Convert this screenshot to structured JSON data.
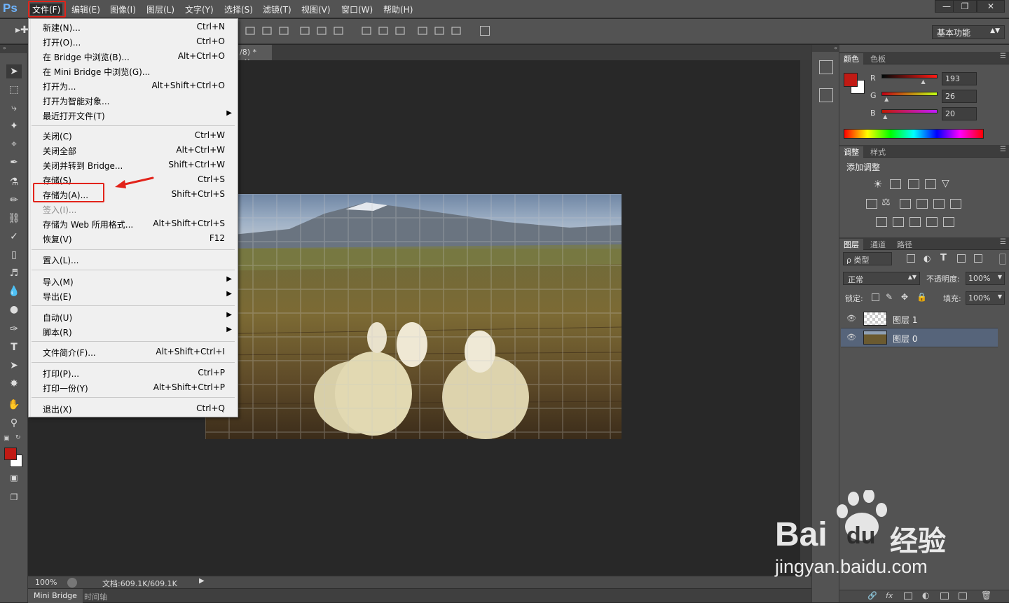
{
  "app": {
    "logo": "Ps"
  },
  "menubar": {
    "items": [
      {
        "label": "文件(F)",
        "active": true
      },
      {
        "label": "编辑(E)"
      },
      {
        "label": "图像(I)"
      },
      {
        "label": "图层(L)"
      },
      {
        "label": "文字(Y)"
      },
      {
        "label": "选择(S)"
      },
      {
        "label": "滤镜(T)"
      },
      {
        "label": "视图(V)"
      },
      {
        "label": "窗口(W)"
      },
      {
        "label": "帮助(H)"
      }
    ],
    "window_buttons": [
      "minimize-icon",
      "restore-icon",
      "close-icon"
    ]
  },
  "options_bar": {
    "workspace": "基本功能"
  },
  "document": {
    "tab_title_fragment": "/8) *",
    "tab_close": "×"
  },
  "file_menu": {
    "groups": [
      [
        {
          "label": "新建(N)...",
          "shortcut": "Ctrl+N"
        },
        {
          "label": "打开(O)...",
          "shortcut": "Ctrl+O"
        },
        {
          "label": "在 Bridge 中浏览(B)...",
          "shortcut": "Alt+Ctrl+O"
        },
        {
          "label": "在 Mini Bridge 中浏览(G)...",
          "shortcut": ""
        },
        {
          "label": "打开为...",
          "shortcut": "Alt+Shift+Ctrl+O"
        },
        {
          "label": "打开为智能对象...",
          "shortcut": ""
        },
        {
          "label": "最近打开文件(T)",
          "shortcut": "",
          "submenu": true
        }
      ],
      [
        {
          "label": "关闭(C)",
          "shortcut": "Ctrl+W"
        },
        {
          "label": "关闭全部",
          "shortcut": "Alt+Ctrl+W"
        },
        {
          "label": "关闭并转到 Bridge...",
          "shortcut": "Shift+Ctrl+W"
        },
        {
          "label": "存储(S)",
          "shortcut": "Ctrl+S"
        },
        {
          "label": "存储为(A)...",
          "shortcut": "Shift+Ctrl+S",
          "highlighted": true
        },
        {
          "label": "签入(I)...",
          "shortcut": "",
          "disabled": true
        },
        {
          "label": "存储为 Web 所用格式...",
          "shortcut": "Alt+Shift+Ctrl+S"
        },
        {
          "label": "恢复(V)",
          "shortcut": "F12"
        }
      ],
      [
        {
          "label": "置入(L)...",
          "shortcut": ""
        }
      ],
      [
        {
          "label": "导入(M)",
          "shortcut": "",
          "submenu": true
        },
        {
          "label": "导出(E)",
          "shortcut": "",
          "submenu": true
        }
      ],
      [
        {
          "label": "自动(U)",
          "shortcut": "",
          "submenu": true
        },
        {
          "label": "脚本(R)",
          "shortcut": "",
          "submenu": true
        }
      ],
      [
        {
          "label": "文件简介(F)...",
          "shortcut": "Alt+Shift+Ctrl+I"
        }
      ],
      [
        {
          "label": "打印(P)...",
          "shortcut": "Ctrl+P"
        },
        {
          "label": "打印一份(Y)",
          "shortcut": "Alt+Shift+Ctrl+P"
        }
      ],
      [
        {
          "label": "退出(X)",
          "shortcut": "Ctrl+Q"
        }
      ]
    ]
  },
  "status": {
    "zoom": "100%",
    "doc_info": "文档:609.1K/609.1K"
  },
  "bottom_tabs": [
    "Mini Bridge",
    "时间轴"
  ],
  "color_panel": {
    "tabs": [
      "颜色",
      "色板"
    ],
    "r_label": "R",
    "g_label": "G",
    "b_label": "B",
    "r": "193",
    "g": "26",
    "b": "20",
    "foreground": "#c11a14",
    "r_level": 0.757,
    "g_level": 0.102,
    "b_level": 0.078
  },
  "adjust_panel": {
    "tabs": [
      "调整",
      "样式"
    ],
    "title": "添加调整"
  },
  "layers_panel": {
    "tabs": [
      "图层",
      "通道",
      "路径"
    ],
    "filter": "ρ 类型",
    "blend_mode": "正常",
    "opacity_label": "不透明度:",
    "opacity": "100%",
    "lock_label": "锁定:",
    "fill_label": "填充:",
    "fill": "100%",
    "layers": [
      {
        "name": "图层 1",
        "selected": false
      },
      {
        "name": "图层 0",
        "selected": true
      }
    ]
  },
  "watermark": {
    "brand": "Bai",
    "brand2": "du",
    "cn": "经验",
    "url": "jingyan.baidu.com"
  }
}
